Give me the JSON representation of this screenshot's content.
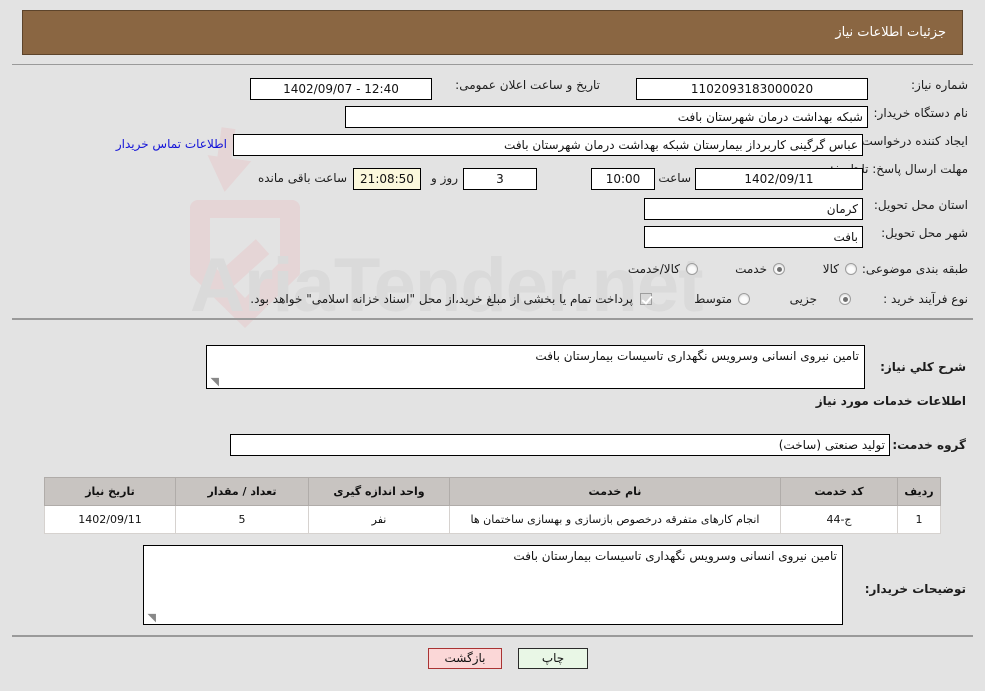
{
  "header": {
    "title": "جزئیات اطلاعات نیاز"
  },
  "form": {
    "need_number": {
      "label": "شماره نیاز:",
      "value": "1102093183000020"
    },
    "public_announce": {
      "label": "تاریخ و ساعت اعلان عمومی:",
      "value": "1402/09/07 - 12:40"
    },
    "buyer_org": {
      "label": "نام دستگاه خریدار:",
      "value": "شبکه بهداشت درمان شهرستان بافت"
    },
    "creator": {
      "label": "ایجاد کننده درخواست:",
      "value": "عباس  گرگینی کاربرداز بیمارستان شبکه بهداشت درمان شهرستان بافت"
    },
    "contact_link": "اطلاعات تماس خریدار",
    "deadline": {
      "label": "مهلت ارسال پاسخ: تا تاریخ:",
      "date": "1402/09/11",
      "hour_label": "ساعت",
      "hour": "10:00",
      "days": "3",
      "days_label": "روز و",
      "countdown": "21:08:50",
      "remaining_label": "ساعت باقی مانده"
    },
    "province": {
      "label": "استان محل تحویل:",
      "value": "کرمان"
    },
    "city": {
      "label": "شهر محل تحویل:",
      "value": "بافت"
    },
    "category": {
      "label": "طبقه بندی موضوعی:",
      "options": [
        "کالا",
        "خدمت",
        "کالا/خدمت"
      ],
      "selected": "خدمت"
    },
    "purchase_type": {
      "label": "نوع فرآیند خرید :",
      "options": [
        "جزیی",
        "متوسط"
      ],
      "selected": "جزیی"
    },
    "treasury": {
      "checked": true,
      "text": "پرداخت تمام یا بخشی از مبلغ خرید،از محل \"اسناد خزانه اسلامی\" خواهد بود."
    }
  },
  "main": {
    "general_desc": {
      "label": "شرح کلي نیاز:",
      "value": "تامین نیروی انسانی وسرویس نگهداری تاسیسات بیمارستان بافت"
    },
    "services_heading": "اطلاعات خدمات مورد نیاز",
    "service_group": {
      "label": "گروه خدمت:",
      "value": "تولید صنعتی (ساخت)"
    },
    "buyer_notes": {
      "label": "توضیحات خریدار:",
      "value": "تامین نیروی انسانی وسرویس نگهداری تاسیسات بیمارستان بافت"
    }
  },
  "table": {
    "columns": [
      "ردیف",
      "کد خدمت",
      "نام خدمت",
      "واحد اندازه گیری",
      "تعداد / مقدار",
      "تاریخ نیاز"
    ],
    "rows": [
      {
        "row_no": "1",
        "service_code": "ج-44",
        "service_name": "انجام کارهای متفرقه درخصوص بازسازی و بهسازی ساختمان ها",
        "unit": "نفر",
        "quantity": "5",
        "need_date": "1402/09/11"
      }
    ]
  },
  "footer": {
    "print_label": "چاپ",
    "back_label": "بازگشت"
  },
  "watermark": {
    "text": "AriaTender.net"
  },
  "colors": {
    "header_bg": "#8a6642",
    "page_bg": "#e3e3e3",
    "link": "#1414d8",
    "back_btn": "#fbd7d7",
    "print_btn": "#e9f7e6"
  }
}
